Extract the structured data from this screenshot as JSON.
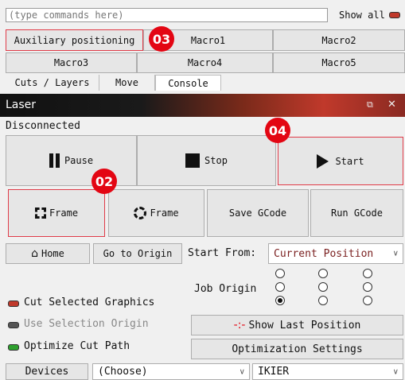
{
  "command_input": {
    "placeholder": "(type commands here)"
  },
  "show_all": {
    "label": "Show all"
  },
  "macros": {
    "aux": "Auxiliary positioning",
    "m1": "Macro1",
    "m2": "Macro2",
    "m3": "Macro3",
    "m4": "Macro4",
    "m5": "Macro5"
  },
  "tabs": [
    "Cuts / Layers",
    "Move",
    "Console"
  ],
  "laser_panel": {
    "title": "Laser",
    "status": "Disconnected"
  },
  "buttons": {
    "pause": "Pause",
    "stop": "Stop",
    "start": "Start",
    "frame1": "Frame",
    "frame2": "Frame",
    "save_gcode": "Save GCode",
    "run_gcode": "Run GCode",
    "home": "Home",
    "go_to_origin": "Go to Origin",
    "show_last_position": "Show Last Position",
    "optimization_settings": "Optimization Settings",
    "devices": "Devices"
  },
  "start_from": {
    "label": "Start From:",
    "value": "Current Position"
  },
  "job_origin": {
    "label": "Job Origin",
    "selected_index": 6
  },
  "options": {
    "cut_selected": "Cut Selected Graphics",
    "use_selection_origin": "Use Selection Origin",
    "optimize_cut_path": "Optimize Cut Path"
  },
  "device_select": {
    "choose": "(Choose)",
    "device": "IKIER"
  },
  "callouts": {
    "c02": "02",
    "c03": "03",
    "c04": "04"
  },
  "colors": {
    "callout_red": "#e30613",
    "highlight_border": "#e03b48",
    "title_bar": "#1a1a1a"
  }
}
